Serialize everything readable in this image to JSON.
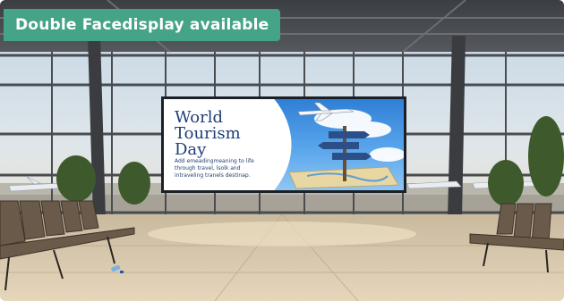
{
  "badge": {
    "text": "Double Facedisplay available"
  },
  "billboard": {
    "title": "World\nTourism\nDay",
    "tagline": "Add emeadingmeaning to life\nthrough travel, lsolk and\nintraveling tranels destinap."
  },
  "colors": {
    "badge_bg": "#45a387",
    "badge_text": "#ffffff",
    "screen_sky": "#3b8be0",
    "title_text": "#1f3f7a"
  },
  "icons": [
    "airplane-icon",
    "signpost-icon",
    "map-icon",
    "water-bottle-icon"
  ]
}
